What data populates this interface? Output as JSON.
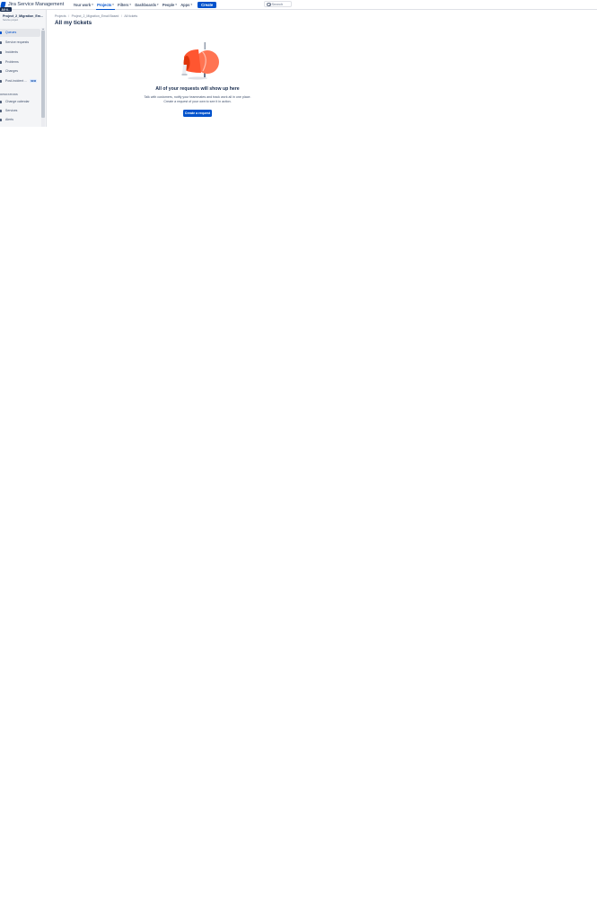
{
  "app": {
    "brand_name": "Jira Service Management"
  },
  "topnav": {
    "items": [
      {
        "label": "Your work",
        "has_menu": true,
        "active": false
      },
      {
        "label": "Projects",
        "has_menu": true,
        "active": true
      },
      {
        "label": "Filters",
        "has_menu": true,
        "active": false
      },
      {
        "label": "Dashboards",
        "has_menu": true,
        "active": false
      },
      {
        "label": "People",
        "has_menu": true,
        "active": false
      },
      {
        "label": "Apps",
        "has_menu": true,
        "active": false
      }
    ],
    "create_label": "Create",
    "search_placeholder": "Search"
  },
  "shortcut_badge": "All ti...",
  "sidebar": {
    "project_name": "Project_2_Migration_Em...",
    "project_type": "Service project",
    "items": [
      {
        "label": "Queues",
        "active": true,
        "icon": "queues-icon"
      },
      {
        "label": "Service requests",
        "active": false,
        "icon": "service-requests-icon"
      },
      {
        "label": "Incidents",
        "active": false,
        "icon": "incidents-icon"
      },
      {
        "label": "Problems",
        "active": false,
        "icon": "problems-icon"
      },
      {
        "label": "Changes",
        "active": false,
        "icon": "changes-icon"
      },
      {
        "label": "Post-incident ...",
        "active": false,
        "icon": "post-incident-icon",
        "lozenge": "NEW"
      }
    ],
    "section_title": "OPERATIONS",
    "operations": [
      {
        "label": "Change calendar",
        "icon": "calendar-icon"
      },
      {
        "label": "Services",
        "icon": "services-icon"
      },
      {
        "label": "Alerts",
        "icon": "alerts-icon"
      }
    ]
  },
  "breadcrumb": [
    "Projects",
    "Project_2_Migration_Email Based",
    "All tickets"
  ],
  "page_title": "All my tickets",
  "empty_state": {
    "title": "All of your requests will show up here",
    "line1": "Talk with customers, notify your teammates and track work all in one place.",
    "line2": "Create a request of your own to see it in action.",
    "button_label": "Create a request",
    "illustration_icon": "megaphone-illustration"
  },
  "colors": {
    "primary": "#0052cc",
    "megaphone": "#ff5630",
    "sidebar_bg": "#f4f5f7"
  }
}
